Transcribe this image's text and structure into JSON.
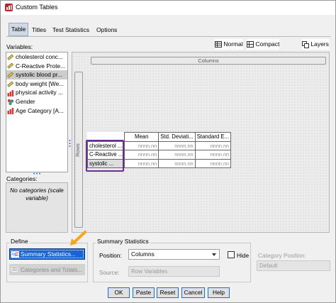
{
  "window": {
    "title": "Custom Tables"
  },
  "tabs": [
    "Table",
    "Titles",
    "Test Statistics",
    "Options"
  ],
  "view_toggle": {
    "normal": "Normal",
    "compact": "Compact",
    "layers": "Layers"
  },
  "variables": {
    "label": "Variables:",
    "items": [
      {
        "label": "cholesterol conc...",
        "type": "scale"
      },
      {
        "label": "C-Reactive Prote...",
        "type": "scale"
      },
      {
        "label": "systolic blood pr...",
        "type": "scale",
        "selected": true
      },
      {
        "label": "body weight [We...",
        "type": "scale"
      },
      {
        "label": "physical activity ...",
        "type": "ordinal"
      },
      {
        "label": "Gender",
        "type": "nominal"
      },
      {
        "label": "Age Category [A...",
        "type": "ordinal"
      }
    ]
  },
  "categories": {
    "label": "Categories:",
    "empty_text": "No categories (scale variable)"
  },
  "canvas": {
    "columns_label": "Columns",
    "rows_label": "Rows",
    "table": {
      "headers": [
        "Mean",
        "Std. Deviati...",
        "Standard E..."
      ],
      "rows": [
        {
          "label": "cholesterol ...",
          "values": [
            "nnnn.nn",
            "nnnn.nn",
            "nnnn.nn"
          ]
        },
        {
          "label": "C-Reactive ...",
          "values": [
            "nnnn.nn",
            "nnnn.nn",
            "nnnn.nn"
          ]
        },
        {
          "label": "systolic ...",
          "values": [
            "nnnn.nn",
            "nnnn.nn",
            "nnnn.nn"
          ]
        }
      ]
    }
  },
  "define": {
    "label": "Define",
    "summary_button": "Summary Statistics...",
    "categories_button": "Categories and Totals..."
  },
  "summary_statistics": {
    "label": "Summary Statistics",
    "position_label": "Position:",
    "position_value": "Columns",
    "hide_label": "Hide",
    "source_label": "Source:",
    "source_value": "Row Variables",
    "category_position_label": "Category Position:",
    "category_position_value": "Default"
  },
  "buttons": [
    "OK",
    "Paste",
    "Reset",
    "Cancel",
    "Help"
  ],
  "colors": {
    "accent": "#1764d6",
    "highlight": "#6a2c96",
    "arrow": "#f4a71d"
  }
}
